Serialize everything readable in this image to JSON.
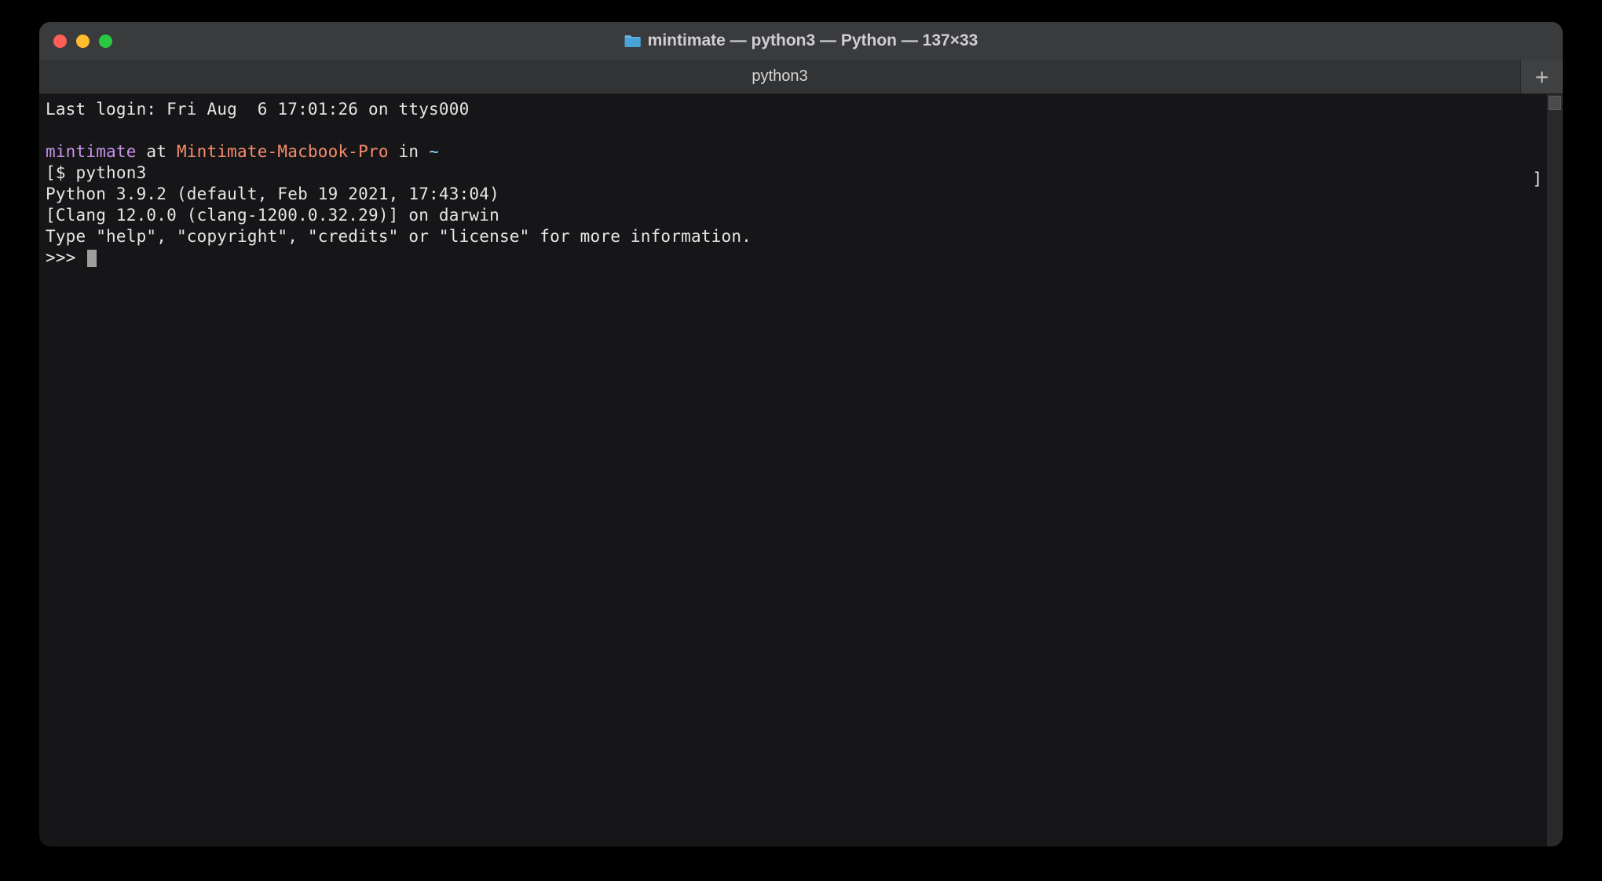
{
  "window": {
    "title": "mintimate — python3 — Python — 137×33"
  },
  "tab": {
    "label": "python3"
  },
  "terminal": {
    "last_login": "Last login: Fri Aug  6 17:01:26 on ttys000",
    "prompt": {
      "user": "mintimate",
      "at": " at ",
      "host": "Mintimate-Macbook-Pro",
      "in": " in ",
      "path": "~",
      "bracket_open": "[",
      "symbol": "$ ",
      "command": "python3",
      "bracket_close": "]"
    },
    "output_line1": "Python 3.9.2 (default, Feb 19 2021, 17:43:04) ",
    "output_line2": "[Clang 12.0.0 (clang-1200.0.32.29)] on darwin",
    "output_line3": "Type \"help\", \"copyright\", \"credits\" or \"license\" for more information.",
    "repl_prompt": ">>> "
  },
  "icons": {
    "plus": "+"
  }
}
